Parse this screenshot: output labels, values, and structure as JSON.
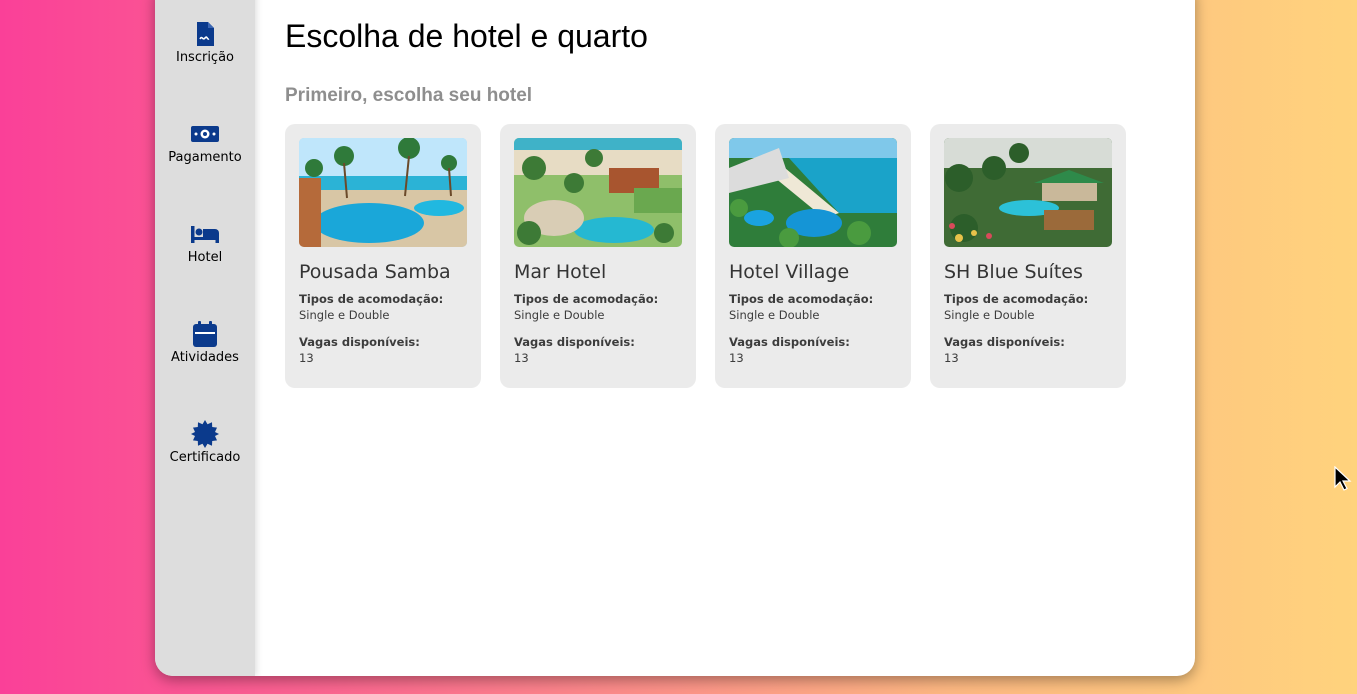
{
  "sidebar": {
    "items": [
      {
        "label": "Inscrição",
        "icon": "file-signature-icon"
      },
      {
        "label": "Pagamento",
        "icon": "money-bill-icon"
      },
      {
        "label": "Hotel",
        "icon": "bed-icon"
      },
      {
        "label": "Atividades",
        "icon": "calendar-icon"
      },
      {
        "label": "Certificado",
        "icon": "certificate-icon"
      }
    ]
  },
  "main": {
    "title": "Escolha de hotel e quarto",
    "subtitle": "Primeiro, escolha seu hotel",
    "hotels": [
      {
        "name": "Pousada Samba",
        "types_label": "Tipos de acomodação:",
        "types_value": "Single e Double",
        "vacancies_label": "Vagas disponíveis:",
        "vacancies_value": "13"
      },
      {
        "name": "Mar Hotel",
        "types_label": "Tipos de acomodação:",
        "types_value": "Single e Double",
        "vacancies_label": "Vagas disponíveis:",
        "vacancies_value": "13"
      },
      {
        "name": "Hotel Village",
        "types_label": "Tipos de acomodação:",
        "types_value": "Single e Double",
        "vacancies_label": "Vagas disponíveis:",
        "vacancies_value": "13"
      },
      {
        "name": "SH Blue Suítes",
        "types_label": "Tipos de acomodação:",
        "types_value": "Single e Double",
        "vacancies_label": "Vagas disponíveis:",
        "vacancies_value": "13"
      }
    ]
  },
  "colors": {
    "icon": "#0b3a8c",
    "sidebar_bg": "#dddddd",
    "card_bg": "#ebebeb",
    "subtitle": "#8e8e8e"
  }
}
